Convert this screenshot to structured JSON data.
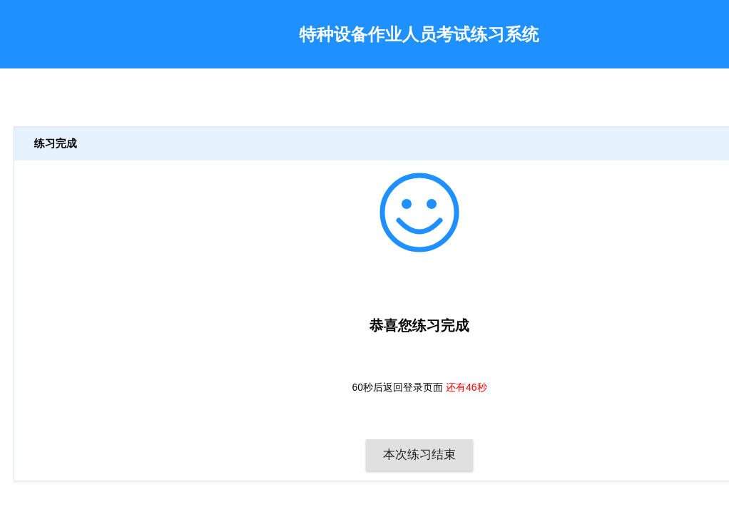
{
  "header": {
    "title": "特种设备作业人员考试练习系统"
  },
  "panel": {
    "title": "练习完成",
    "message": "恭喜您练习完成",
    "countdown": {
      "text": "60秒后返回登录页面",
      "remaining": "还有46秒"
    },
    "button": "本次练习结束"
  }
}
